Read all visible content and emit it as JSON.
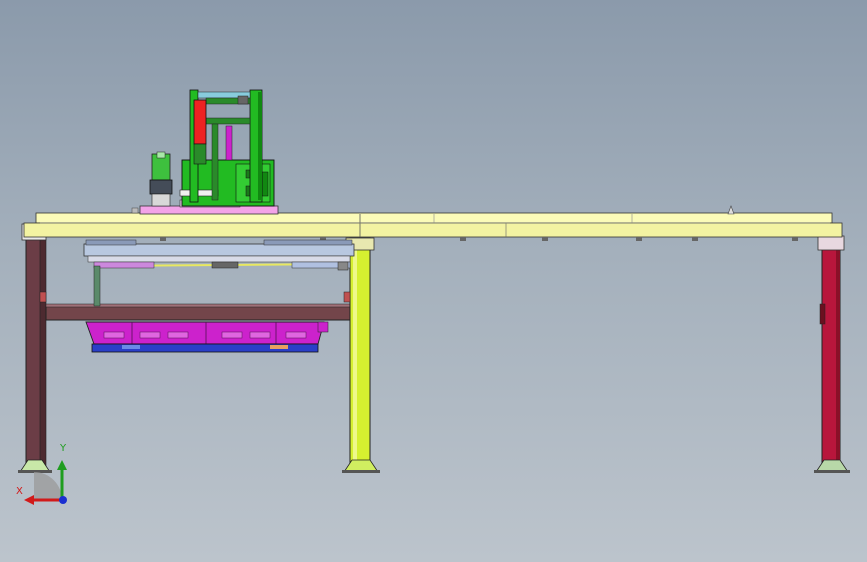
{
  "view": {
    "background_top": "#8b9aab",
    "background_bottom": "#bcc4cc"
  },
  "triad": {
    "x_label": "X",
    "y_label": "Y",
    "x_color": "#d11a1a",
    "y_color": "#1f9d1f",
    "z_color": "#1a2fd1"
  },
  "parts": {
    "left_leg": "#6b3d46",
    "middle_leg": "#d6f030",
    "right_leg": "#b8163c",
    "table_top": "#fbfbb8",
    "table_front": "#f3f3a2",
    "cross_beam": "#73454a",
    "hopper": "#cc22cc",
    "tray": "#2a3fc8",
    "frame_green": "#22bb22",
    "cylinder": "#ee2222",
    "carriage": "#f3a3e8"
  }
}
